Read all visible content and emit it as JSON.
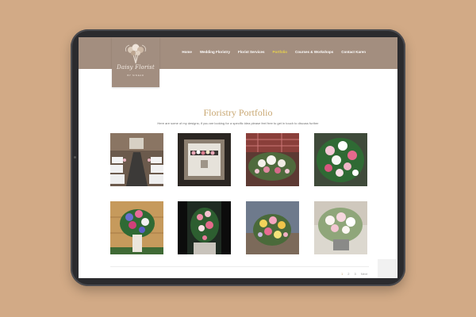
{
  "logo": {
    "script_text": "Daisy Florist",
    "sub_text": "BY SINEAD"
  },
  "nav": {
    "items": [
      {
        "label": "Home",
        "active": false
      },
      {
        "label": "Wedding Floristry",
        "active": false
      },
      {
        "label": "Florist Services",
        "active": false
      },
      {
        "label": "Portfolio",
        "active": true
      },
      {
        "label": "Courses & Workshops",
        "active": false
      },
      {
        "label": "Contact Karen",
        "active": false
      }
    ]
  },
  "page": {
    "title": "Floristry Portfolio",
    "intro": "Here are some of my designs; if you are looking for a specific idea please feel free to get in touch to discuss further"
  },
  "gallery": {
    "images": [
      {
        "subject": "ceremony-aisle-photo"
      },
      {
        "subject": "framed-mantel-arrangement-photo"
      },
      {
        "subject": "tartan-table-arrangement-photo"
      },
      {
        "subject": "pink-white-arrangement-photo"
      },
      {
        "subject": "blue-pink-basket-photo"
      },
      {
        "subject": "pink-cascade-bouquet-photo"
      },
      {
        "subject": "yellow-pink-arrangement-photo"
      },
      {
        "subject": "white-rose-basket-photo"
      }
    ]
  },
  "pagination": {
    "pages": [
      "1",
      "2",
      "3"
    ],
    "current": "1",
    "next_label": "Next"
  },
  "colors": {
    "background": "#d2aa86",
    "header": "#a38e7f",
    "active_nav": "#e9d34a",
    "title": "#c9a873"
  }
}
